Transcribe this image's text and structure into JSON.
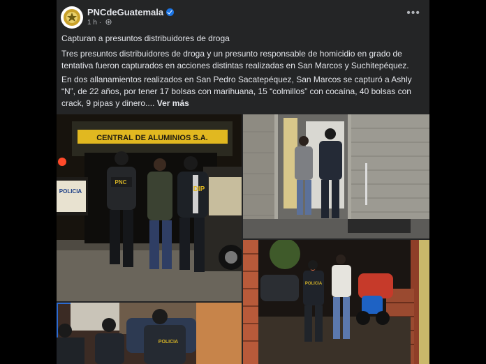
{
  "post": {
    "page_name": "PNCdeGuatemala",
    "time": "1 h",
    "separator": "·",
    "headline": "Capturan a presuntos distribuidores de droga",
    "paragraph1": "Tres presuntos distribuidores de droga y un presunto responsable de homicidio en grado de tentativa fueron capturados en acciones distintas realizadas en San Marcos y Suchitepéquez.",
    "paragraph2": "En dos allanamientos realizados en San Pedro Sacatepéquez, San Marcos se capturó a Ashly “N”, de 22 años, por tener 17 bolsas con marihuana, 15 “colmillos” con cocaína, 40 bolsas con crack, 9 pipas y dinero....",
    "see_more": "Ver más"
  },
  "icons": {
    "verified": "verified-badge-icon",
    "audience": "globe-icon",
    "more": "more-options-icon"
  },
  "photos": {
    "photo1": {
      "sign": "CENTRAL DE ALUMINIOS S.A.",
      "vest_left": "PNC",
      "vest_right": "DIP",
      "car_door": "POLICIA"
    },
    "photo3": {
      "vest": "POLICIA"
    },
    "photo4": {
      "vest": "POLICIA"
    }
  },
  "colors": {
    "card_bg": "#242526",
    "text": "#e4e6eb",
    "muted": "#b0b3b8",
    "verified": "#1b74e4"
  }
}
